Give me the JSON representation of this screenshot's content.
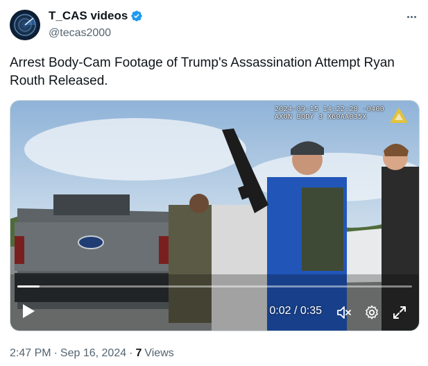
{
  "author": {
    "display_name": "T_CAS videos",
    "handle": "@tecas2000",
    "verified": true
  },
  "tweet": {
    "text": "Arrest Body-Cam Footage of Trump's Assassination Attempt Ryan Routh Released."
  },
  "video": {
    "overlay_line1": "2024-09-15 14:22:28 -0400",
    "overlay_line2": "AXON BODY 3 X60AA035X",
    "time": "0:02 / 0:35",
    "progress": 0.057
  },
  "meta": {
    "time": "2:47 PM",
    "sep1": "·",
    "date": "Sep 16, 2024",
    "sep2": "·",
    "views_count": "7",
    "views_label": "Views"
  },
  "colors": {
    "text_primary": "#0f1419",
    "text_secondary": "#536471",
    "verified_blue": "#1d9bf0"
  },
  "icons": [
    "more-icon",
    "verified-badge-icon",
    "play-icon",
    "mute-icon",
    "settings-icon",
    "fullscreen-icon"
  ]
}
